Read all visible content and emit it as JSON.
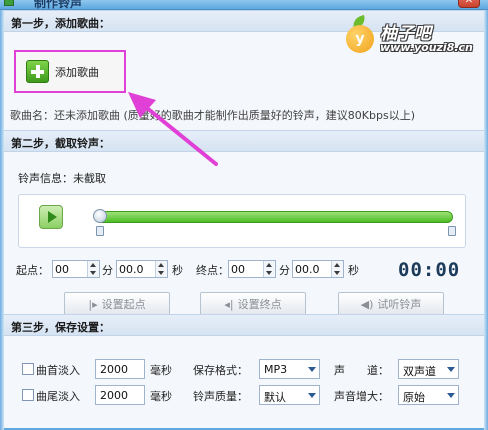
{
  "window": {
    "title": "制作铃声",
    "close_glyph": "✕"
  },
  "logo": {
    "mark": "y",
    "name": "柚子吧",
    "url": "www.youzi8.cn"
  },
  "step1": {
    "title": "第一步，添加歌曲：",
    "add_button_label": "添加歌曲",
    "song_info": "歌曲名：还未添加歌曲    (质量好的歌曲才能制作出质量好的铃声，建议80Kbps以上)"
  },
  "step2": {
    "title": "第二步，截取铃声：",
    "ring_info": "铃声信息：未截取",
    "player": {
      "icon": "play-icon",
      "accent": "#4cbd25"
    },
    "start": {
      "label": "起点：",
      "min_value": "00",
      "min_unit": "分",
      "sec_value": "00.0",
      "sec_unit": "秒"
    },
    "end": {
      "label": "终点：",
      "min_value": "00",
      "min_unit": "分",
      "sec_value": "00.0",
      "sec_unit": "秒"
    },
    "timer": "00:00",
    "buttons": {
      "set_start": "设置起点",
      "set_end": "设置终点",
      "preview": "试听铃声"
    }
  },
  "step3": {
    "title": "第三步，保存设置：",
    "fade_in": {
      "label": "曲首淡入",
      "value": "2000",
      "unit": "毫秒"
    },
    "fade_out": {
      "label": "曲尾淡入",
      "value": "2000",
      "unit": "毫秒"
    },
    "save_format": {
      "label": "保存格式：",
      "value": "MP3"
    },
    "ring_quality": {
      "label": "铃声质量：",
      "value": "默认"
    },
    "channel": {
      "label": "声　　道：",
      "value": "双声道"
    },
    "volume_boost": {
      "label": "声音增大：",
      "value": "原始"
    }
  },
  "colors": {
    "highlight_box": "#e040d6",
    "arrow": "#e040d6",
    "section_bar": "#d6e3f2"
  }
}
